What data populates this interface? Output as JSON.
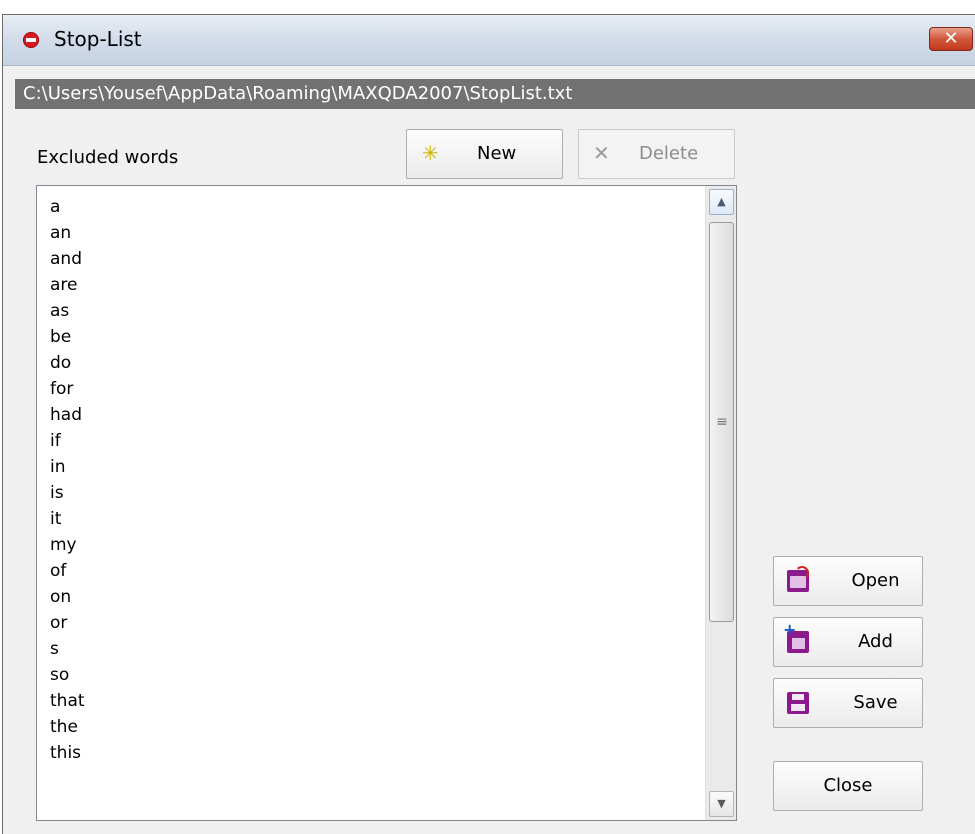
{
  "window": {
    "title": "Stop-List",
    "close_glyph": "✕",
    "title_icon": "stop-icon",
    "accent_close": "#c2391c"
  },
  "path": "C:\\Users\\Yousef\\AppData\\Roaming\\MAXQDA2007\\StopList.txt",
  "list": {
    "label": "Excluded words",
    "items": [
      "a",
      "an",
      "and",
      "are",
      "as",
      "be",
      "do",
      "for",
      "had",
      "if",
      "in",
      "is",
      "it",
      "my",
      "of",
      "on",
      "or",
      "s",
      "so",
      "that",
      "the",
      "this"
    ]
  },
  "toolbar": {
    "new_label": "New",
    "new_icon": "sparkle-icon",
    "new_glyph": "✳",
    "delete_label": "Delete",
    "delete_icon": "x-icon",
    "delete_glyph": "✕"
  },
  "scrollbar": {
    "up_glyph": "▲",
    "down_glyph": "▼",
    "grip_glyph": "≡"
  },
  "side_buttons": {
    "open_label": "Open",
    "open_icon": "open-folder-icon",
    "add_label": "Add",
    "add_icon": "add-file-icon",
    "save_label": "Save",
    "save_icon": "floppy-disk-icon",
    "close_label": "Close"
  }
}
